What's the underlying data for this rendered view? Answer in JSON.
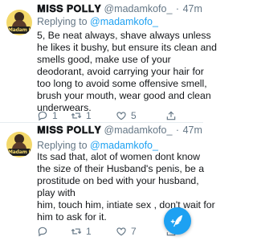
{
  "tweets": [
    {
      "display_name": "𝐌𝐈𝐒𝐒 𝐏𝐎𝐋𝐋𝐘",
      "handle": "@madamkofo_",
      "dot": "·",
      "time": "47m",
      "avatar_label": "Madam KOFO",
      "reply_prefix": "Replying to ",
      "reply_to": "@madamkofo_",
      "lines": [
        "5, Be neat always, shave always unless",
        "he likes it bushy, but ensure its clean and",
        "smells good, make use of your",
        "deodorant, avoid carrying your hair for",
        "too long to avoid some offensive smell,",
        "brush your mouth, wear good and clean",
        "underwears."
      ],
      "actions": {
        "reply_count": "1",
        "retweet_count": "1",
        "like_count": "5"
      }
    },
    {
      "display_name": "𝐌𝐈𝐒𝐒 𝐏𝐎𝐋𝐋𝐘",
      "handle": "@madamkofo_",
      "dot": "·",
      "time": "47m",
      "avatar_label": "Madam KOFO",
      "reply_prefix": "Replying to ",
      "reply_to": "@madamkofo_",
      "lines": [
        "Its sad that, alot of women dont know",
        "the size of their Husband's penis, be a",
        "prostitude on bed with your husband,",
        "play with",
        "him, touch him, intiate sex , don't wait for",
        "him to ask for it."
      ],
      "actions": {
        "reply_count": "",
        "retweet_count": "1",
        "like_count": "7"
      }
    }
  ],
  "icons": {
    "reply": "reply-icon",
    "retweet": "retweet-icon",
    "like": "heart-icon",
    "share": "share-icon",
    "compose": "compose-tweet-icon",
    "more": "chevron-down-icon"
  },
  "colors": {
    "accent": "#1da1f2",
    "text": "#14171a",
    "secondary": "#657786",
    "divider": "#e6ecf0",
    "avatar_bg": "#f3d86a"
  }
}
